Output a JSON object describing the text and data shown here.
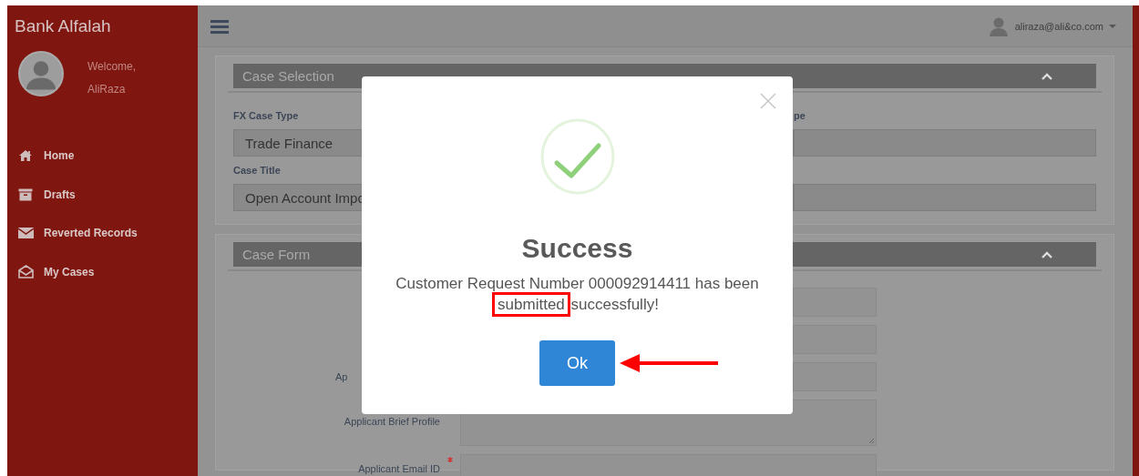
{
  "sidebar": {
    "brand": "Bank Alfalah",
    "welcome": "Welcome,",
    "user": "AliRaza",
    "items": [
      {
        "label": "Home",
        "kind": "home"
      },
      {
        "label": "Drafts",
        "kind": "drafts"
      },
      {
        "label": "Reverted Records",
        "kind": "mail"
      },
      {
        "label": "My Cases",
        "kind": "open-mail"
      }
    ]
  },
  "topbar": {
    "email": "aliraza@ali&co.com"
  },
  "case_selection": {
    "title": "Case Selection",
    "right_label": "pe",
    "fields": [
      {
        "label": "FX Case Type",
        "value": "Trade Finance"
      },
      {
        "label": "Case Title",
        "value": "Open Account Impo"
      }
    ]
  },
  "case_form": {
    "title": "Case Form",
    "rows": [
      {
        "kind": "input"
      },
      {
        "kind": "input"
      },
      {
        "kind": "input",
        "label": "Ap"
      },
      {
        "kind": "textarea",
        "label": "Applicant Brief Profile"
      },
      {
        "kind": "input",
        "label": "Applicant Email ID",
        "required": true
      }
    ]
  },
  "modal": {
    "title": "Success",
    "button": "Ok",
    "message": [
      {
        "text": "Customer Request Number 000092914411 has been ",
        "highlighted": false
      },
      {
        "text": "submitted",
        "highlighted": true
      },
      {
        "text": " successfully!",
        "highlighted": false
      }
    ]
  }
}
